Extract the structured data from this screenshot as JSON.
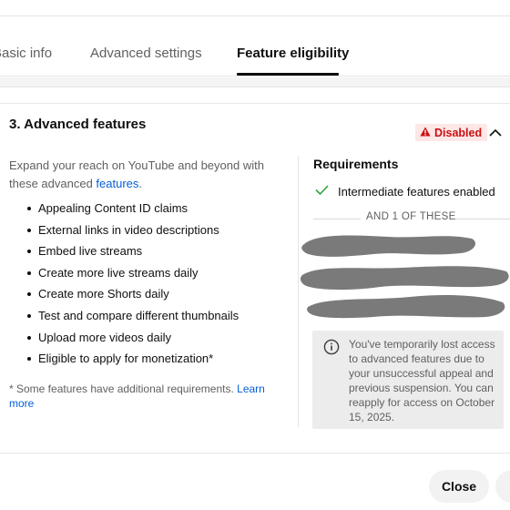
{
  "tabs": [
    {
      "label": "Basic info",
      "active": false
    },
    {
      "label": "Advanced settings",
      "active": false
    },
    {
      "label": "Feature eligibility",
      "active": true
    }
  ],
  "section": {
    "title": "3. Advanced features",
    "badge": {
      "label": "Disabled",
      "icon": "warning-icon",
      "color": "#cc1010"
    },
    "collapse_icon": "chevron-up-icon",
    "intro_text": "Expand your reach on YouTube and beyond with these advanced",
    "intro_link": "features",
    "intro_suffix": ".",
    "features": [
      "Appealing Content ID claims",
      "External links in video descriptions",
      "Embed live streams",
      "Create more live streams daily",
      "Create more Shorts daily",
      "Test and compare different thumbnails",
      "Upload more videos daily",
      "Eligible to apply for monetization*"
    ],
    "footnote_text": "* Some features have additional requirements.",
    "footnote_link": "Learn more"
  },
  "requirements": {
    "title": "Requirements",
    "items": [
      {
        "label": "Intermediate features enabled",
        "icon": "check-icon",
        "met": true
      }
    ],
    "separator": "AND 1 OF THESE",
    "notice": {
      "icon": "info-icon",
      "text": "You've temporarily lost access to advanced features due to your unsuccessful appeal and previous suspension. You can reapply for access on October 15, 2025."
    }
  },
  "footer": {
    "close_label": "Close"
  },
  "colors": {
    "accent_link": "#065fd4",
    "disabled_red": "#cc1010",
    "check_green": "#2ba640"
  }
}
